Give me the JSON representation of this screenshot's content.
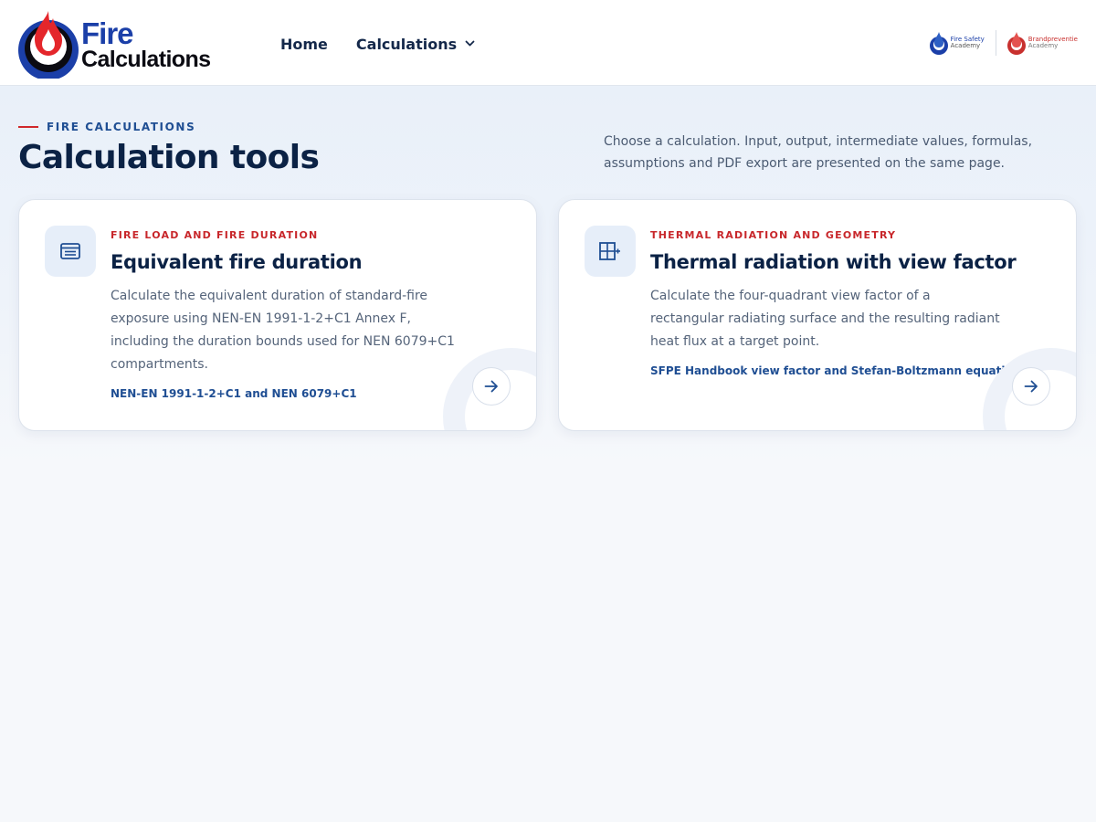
{
  "header": {
    "logo": {
      "line1": "Fire",
      "line2": "Calculations"
    },
    "nav": {
      "home": "Home",
      "calculations": "Calculations"
    },
    "partners": [
      {
        "line1": "Fire Safety",
        "line2": "Academy"
      },
      {
        "line1": "Brandpreventie",
        "line2": "Academy"
      }
    ]
  },
  "hero": {
    "eyebrow": "FIRE CALCULATIONS",
    "title": "Calculation tools",
    "intro": "Choose a calculation. Input, output, intermediate values, formulas, assumptions and PDF export are presented on the same page."
  },
  "cards": [
    {
      "category": "FIRE LOAD AND FIRE DURATION",
      "title": "Equivalent fire duration",
      "description": "Calculate the equivalent duration of standard-fire exposure using NEN-EN 1991-1-2+C1 Annex F, including the duration bounds used for NEN 6079+C1 compartments.",
      "reference": "NEN-EN 1991-1-2+C1 and NEN 6079+C1",
      "icon": "table-icon"
    },
    {
      "category": "THERMAL RADIATION AND GEOMETRY",
      "title": "Thermal radiation with view factor",
      "description": "Calculate the four-quadrant view factor of a rectangular radiating surface and the resulting radiant heat flux at a target point.",
      "reference": "SFPE Handbook view factor and Stefan-Boltzmann equation",
      "icon": "grid-plus-icon"
    }
  ],
  "colors": {
    "primary_navy": "#0b2245",
    "accent_red": "#c8272b",
    "link_blue": "#1f4e93",
    "icon_bg": "#e6eef9"
  }
}
